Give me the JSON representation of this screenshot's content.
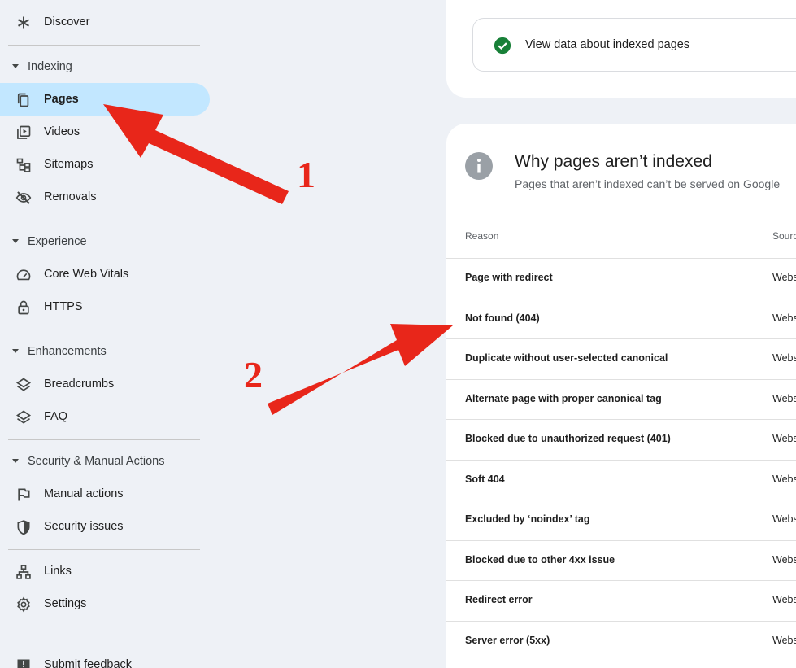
{
  "sidebar": {
    "discover": "Discover",
    "sections": {
      "indexing": "Indexing",
      "experience": "Experience",
      "enhancements": "Enhancements",
      "security": "Security & Manual Actions"
    },
    "items": {
      "pages": "Pages",
      "videos": "Videos",
      "sitemaps": "Sitemaps",
      "removals": "Removals",
      "core_web_vitals": "Core Web Vitals",
      "https": "HTTPS",
      "breadcrumbs": "Breadcrumbs",
      "faq": "FAQ",
      "manual_actions": "Manual actions",
      "security_issues": "Security issues",
      "links": "Links",
      "settings": "Settings",
      "submit_feedback": "Submit feedback"
    }
  },
  "info_pill": {
    "label": "View data about indexed pages",
    "icon": "check-circle-icon",
    "color": "#188038"
  },
  "card": {
    "title": "Why pages aren’t indexed",
    "subtitle": "Pages that aren’t indexed can’t be served on Google",
    "columns": {
      "reason": "Reason",
      "source": "Sourc"
    },
    "rows": [
      {
        "reason": "Page with redirect",
        "source": "Webs"
      },
      {
        "reason": "Not found (404)",
        "source": "Webs"
      },
      {
        "reason": "Duplicate without user-selected canonical",
        "source": "Webs"
      },
      {
        "reason": "Alternate page with proper canonical tag",
        "source": "Webs"
      },
      {
        "reason": "Blocked due to unauthorized request (401)",
        "source": "Webs"
      },
      {
        "reason": "Soft 404",
        "source": "Webs"
      },
      {
        "reason": "Excluded by ‘noindex’ tag",
        "source": "Webs"
      },
      {
        "reason": "Blocked due to other 4xx issue",
        "source": "Webs"
      },
      {
        "reason": "Redirect error",
        "source": "Webs"
      },
      {
        "reason": "Server error (5xx)",
        "source": "Webs"
      }
    ]
  },
  "annotations": {
    "label_1": "1",
    "label_2": "2",
    "color": "#e8261a"
  },
  "colors": {
    "active_nav": "#c2e7ff",
    "sidebar_bg": "#eef1f6"
  }
}
